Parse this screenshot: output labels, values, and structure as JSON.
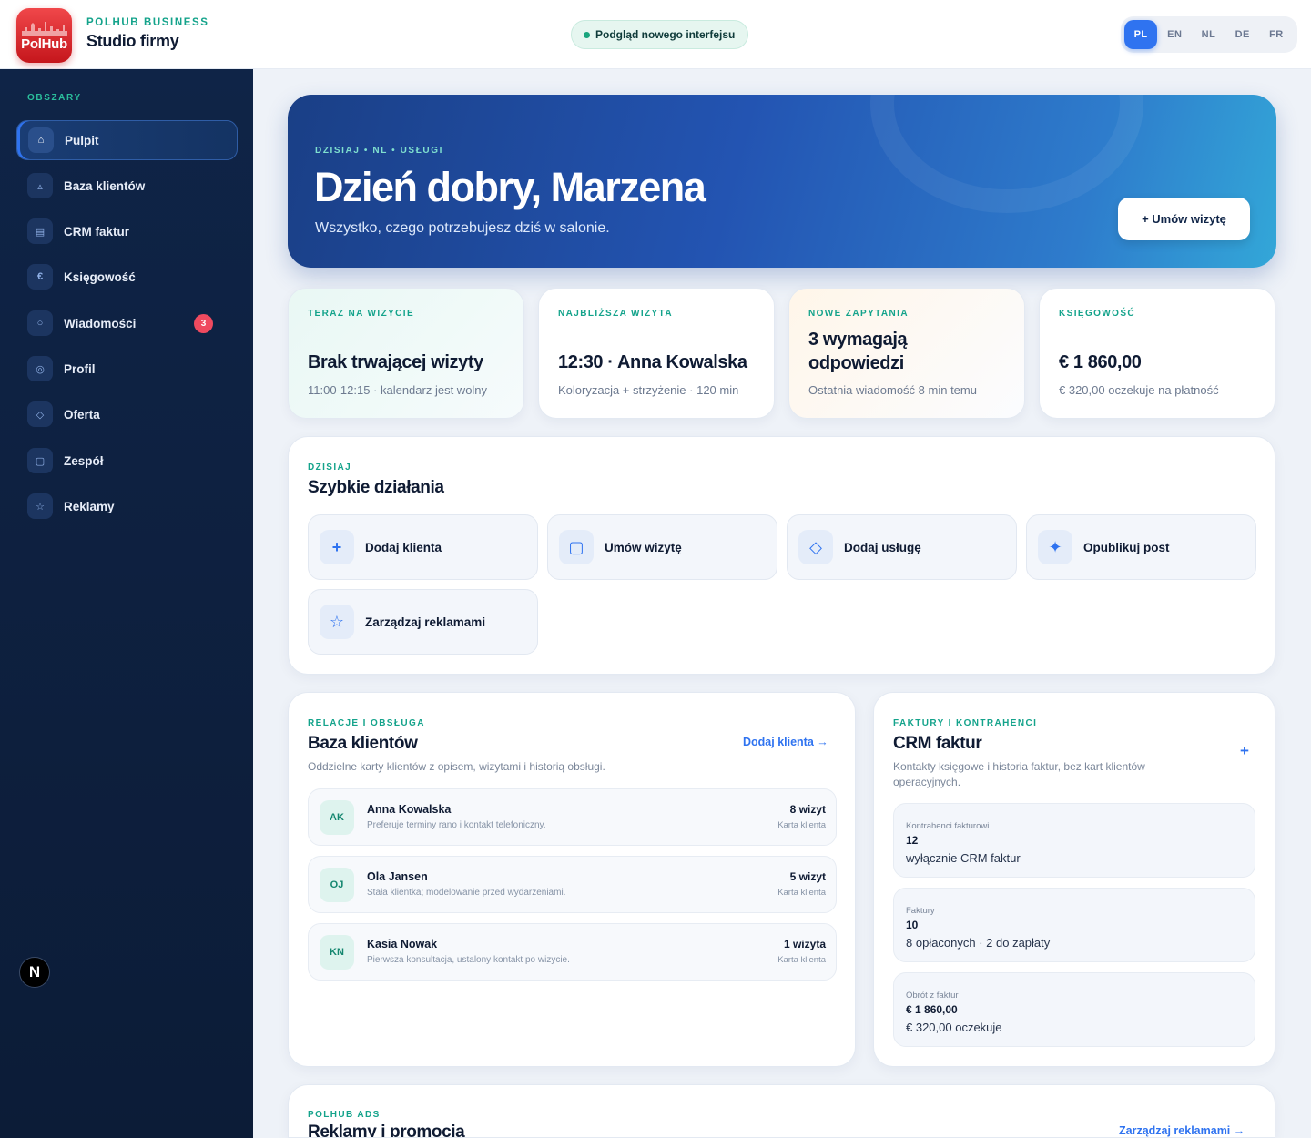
{
  "brand": {
    "logo_text": "PolHub",
    "kicker": "POLHUB BUSINESS",
    "title": "Studio firmy"
  },
  "preview_pill": "Podgląd nowego interfejsu",
  "languages": [
    {
      "code": "PL",
      "active": true
    },
    {
      "code": "EN",
      "active": false
    },
    {
      "code": "NL",
      "active": false
    },
    {
      "code": "DE",
      "active": false
    },
    {
      "code": "FR",
      "active": false
    }
  ],
  "sidebar": {
    "heading": "OBSZARY",
    "items": [
      {
        "label": "Pulpit",
        "icon": "home-icon",
        "glyph": "⌂",
        "active": true
      },
      {
        "label": "Baza klientów",
        "icon": "triangle-icon",
        "glyph": "▵"
      },
      {
        "label": "CRM faktur",
        "icon": "invoice-icon",
        "glyph": "▤"
      },
      {
        "label": "Księgowość",
        "icon": "euro-icon",
        "glyph": "€"
      },
      {
        "label": "Wiadomości",
        "icon": "message-icon",
        "glyph": "○",
        "badge": "3"
      },
      {
        "label": "Profil",
        "icon": "profile-icon",
        "glyph": "◎"
      },
      {
        "label": "Oferta",
        "icon": "diamond-icon",
        "glyph": "◇"
      },
      {
        "label": "Zespół",
        "icon": "team-icon",
        "glyph": "▢"
      },
      {
        "label": "Reklamy",
        "icon": "star-icon",
        "glyph": "☆"
      }
    ],
    "avatar": "N"
  },
  "hero": {
    "kicker": "DZISIAJ • NL • USŁUGI",
    "title": "Dzień dobry, Marzena",
    "subtitle": "Wszystko, czego potrzebujesz dziś w salonie.",
    "cta": "+ Umów wizytę"
  },
  "stats": [
    {
      "kicker": "TERAZ NA WIZYCIE",
      "value": "Brak trwającej wizyty",
      "sub": "11:00-12:15 · kalendarz jest wolny"
    },
    {
      "kicker": "NAJBLIŻSZA WIZYTA",
      "value": "12:30 · Anna Kowalska",
      "sub": "Koloryzacja + strzyżenie · 120 min"
    },
    {
      "kicker": "NOWE ZAPYTANIA",
      "value": "3 wymagają odpowiedzi",
      "sub": "Ostatnia wiadomość 8 min temu"
    },
    {
      "kicker": "KSIĘGOWOŚĆ",
      "value": "€ 1 860,00",
      "sub": "€ 320,00 oczekuje na płatność"
    }
  ],
  "quick_actions": {
    "kicker": "DZISIAJ",
    "title": "Szybkie działania",
    "items": [
      {
        "label": "Dodaj klienta",
        "icon": "plus-icon",
        "glyph": "+"
      },
      {
        "label": "Umów wizytę",
        "icon": "calendar-icon",
        "glyph": "▢"
      },
      {
        "label": "Dodaj usługę",
        "icon": "diamond-icon",
        "glyph": "◇"
      },
      {
        "label": "Opublikuj post",
        "icon": "sparkle-icon",
        "glyph": "✦"
      },
      {
        "label": "Zarządzaj reklamami",
        "icon": "star-icon",
        "glyph": "☆"
      }
    ]
  },
  "clients": {
    "kicker": "RELACJE I OBSŁUGA",
    "title": "Baza klientów",
    "link": "Dodaj klienta →",
    "description": "Oddzielne karty klientów z opisem, wizytami i historią obsługi.",
    "rows": [
      {
        "initials": "AK",
        "name": "Anna Kowalska",
        "note": "Preferuje terminy rano i kontakt telefoniczny.",
        "visits": "8 wizyt",
        "card": "Karta klienta"
      },
      {
        "initials": "OJ",
        "name": "Ola Jansen",
        "note": "Stała klientka; modelowanie przed wydarzeniami.",
        "visits": "5 wizyt",
        "card": "Karta klienta"
      },
      {
        "initials": "KN",
        "name": "Kasia Nowak",
        "note": "Pierwsza konsultacja, ustalony kontakt po wizycie.",
        "visits": "1 wizyta",
        "card": "Karta klienta"
      }
    ]
  },
  "crm": {
    "kicker": "FAKTURY I KONTRAHENCI",
    "title": "CRM faktur",
    "plus": "+",
    "description": "Kontakty księgowe i historia faktur, bez kart klientów operacyjnych.",
    "boxes": [
      {
        "label": "Kontrahenci fakturowi",
        "value": "12",
        "note": "wyłącznie CRM faktur"
      },
      {
        "label": "Faktury",
        "value": "10",
        "note": "8 opłaconych · 2 do zapłaty"
      },
      {
        "label": "Obrót z faktur",
        "value": "€ 1 860,00",
        "note": "€ 320,00 oczekuje"
      }
    ]
  },
  "ads": {
    "kicker": "POLHUB ADS",
    "title": "Reklamy i promocja",
    "link": "Zarządzaj reklamami →"
  }
}
